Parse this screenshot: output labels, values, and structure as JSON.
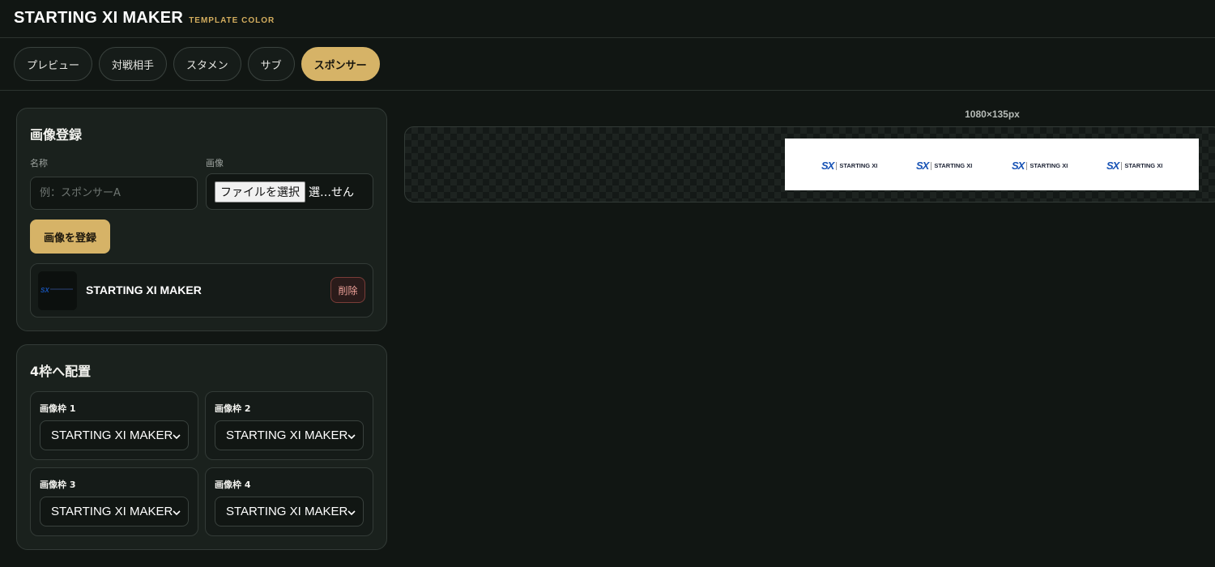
{
  "header": {
    "title": "STARTING XI MAKER",
    "subtitle": "TEMPLATE COLOR"
  },
  "tabs": [
    {
      "label": "プレビュー",
      "active": false
    },
    {
      "label": "対戦相手",
      "active": false
    },
    {
      "label": "スタメン",
      "active": false
    },
    {
      "label": "サブ",
      "active": false
    },
    {
      "label": "スポンサー",
      "active": true
    }
  ],
  "register": {
    "title": "画像登録",
    "name_label": "名称",
    "name_placeholder": "例：スポンサーA",
    "image_label": "画像",
    "file_button": "ファイルを選択",
    "file_status": "選…せん",
    "submit_label": "画像を登録",
    "item": {
      "name": "STARTING XI MAKER",
      "delete_label": "削除"
    }
  },
  "placement": {
    "title": "4枠へ配置",
    "slots": [
      {
        "label": "画像枠 1",
        "value": "STARTING XI MAKER"
      },
      {
        "label": "画像枠 2",
        "value": "STARTING XI MAKER"
      },
      {
        "label": "画像枠 3",
        "value": "STARTING XI MAKER"
      },
      {
        "label": "画像枠 4",
        "value": "STARTING XI MAKER"
      }
    ]
  },
  "preview": {
    "size_label": "1080×135px",
    "logo": {
      "mark": "SX",
      "text": "STARTING XI"
    }
  },
  "colors": {
    "accent": "#d6b367",
    "background": "#111613",
    "panel": "#1a211d",
    "logo_blue": "#1853b5"
  }
}
